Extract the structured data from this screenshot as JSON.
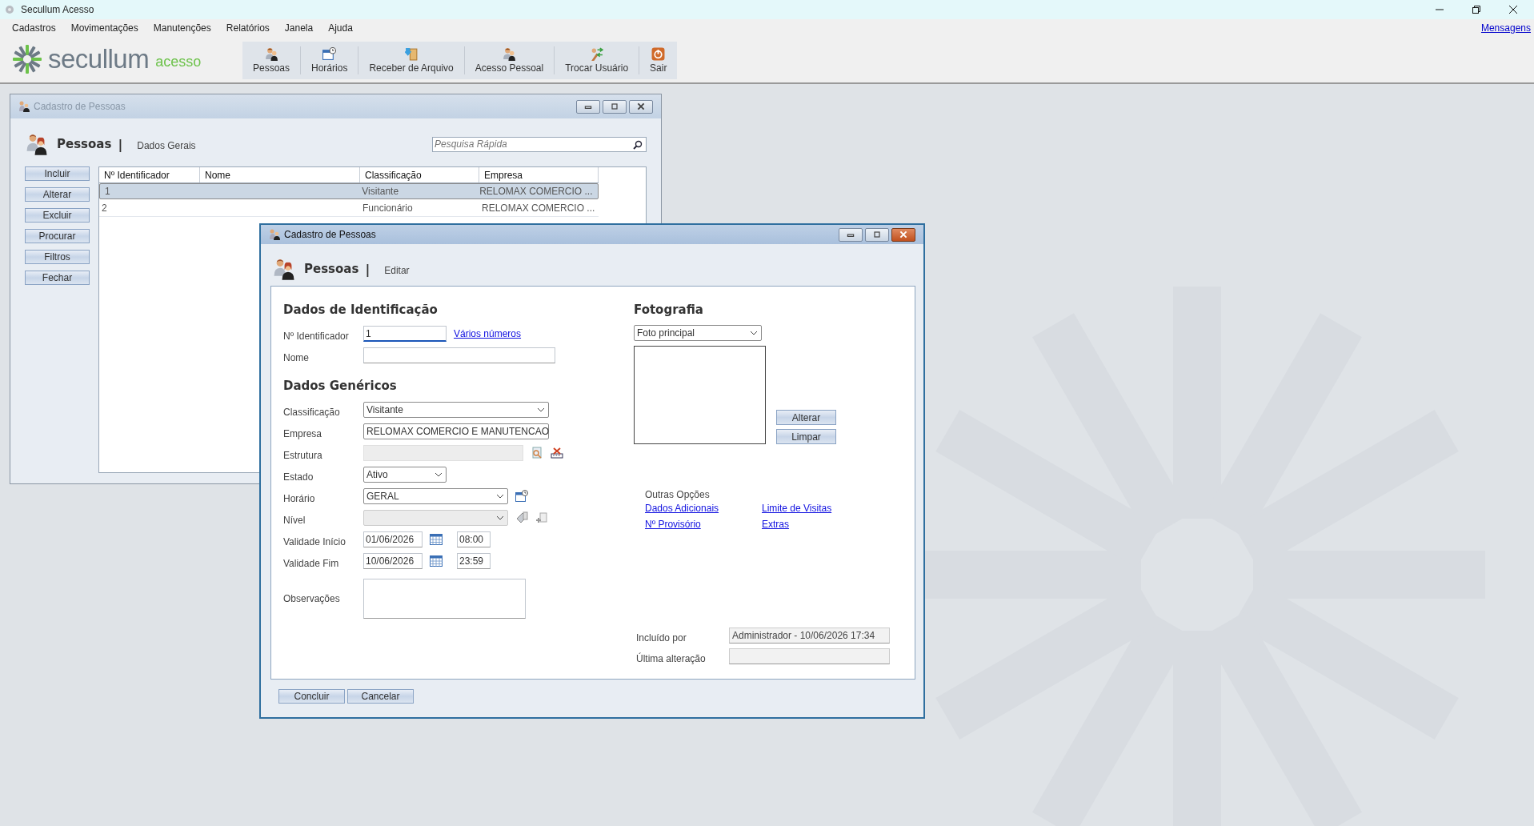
{
  "window": {
    "title": "Secullum Acesso"
  },
  "menu": [
    "Cadastros",
    "Movimentações",
    "Manutenções",
    "Relatórios",
    "Janela",
    "Ajuda"
  ],
  "messages_link": "Mensagens",
  "logo": {
    "name": "secullum",
    "product": "acesso"
  },
  "toolbar": [
    {
      "label": "Pessoas",
      "kind": "person"
    },
    {
      "label": "Horários",
      "kind": "schedule"
    },
    {
      "label": "Receber de Arquivo",
      "kind": "file"
    },
    {
      "label": "Acesso Pessoal",
      "kind": "person"
    },
    {
      "label": "Trocar Usuário",
      "kind": "swap"
    },
    {
      "label": "Sair",
      "kind": "power"
    }
  ],
  "back_window": {
    "title": "Cadastro de Pessoas",
    "heading": "Pessoas",
    "separator": "|",
    "section": "Dados Gerais",
    "search": {
      "placeholder": "Pesquisa Rápida"
    },
    "buttons": [
      "Incluir",
      "Alterar",
      "Excluir",
      "Procurar",
      "Filtros",
      "Fechar"
    ],
    "table": {
      "columns": [
        "Nº Identificador",
        "Nome",
        "Classificação",
        "Empresa"
      ],
      "rows": [
        {
          "cells": [
            "1",
            "",
            "Visitante",
            "RELOMAX COMERCIO ..."
          ],
          "selected": true
        },
        {
          "cells": [
            "2",
            "",
            "Funcionário",
            "RELOMAX COMERCIO ..."
          ],
          "selected": false
        }
      ]
    }
  },
  "dialog": {
    "title": "Cadastro de Pessoas",
    "heading": "Pessoas",
    "separator": "|",
    "section": "Editar",
    "identification": {
      "title": "Dados de Identificação",
      "rows": [
        {
          "kind": "input-link",
          "label": "Nº Identificador",
          "value": "1",
          "link": "Vários números"
        },
        {
          "kind": "input",
          "label": "Nome"
        }
      ]
    },
    "generic": {
      "title": "Dados Genéricos",
      "rows": [
        {
          "kind": "select",
          "label": "Classificação",
          "value": "Visitante"
        },
        {
          "kind": "select",
          "label": "Empresa",
          "value": "RELOMAX COMERCIO E MANUTENCAO"
        },
        {
          "kind": "lookup",
          "label": "Estrutura"
        },
        {
          "kind": "select-short",
          "label": "Estado",
          "value": "Ativo"
        },
        {
          "kind": "select-schedule",
          "label": "Horário",
          "value": "GERAL"
        },
        {
          "kind": "select-disabled",
          "label": "Nível"
        },
        {
          "kind": "datetime",
          "label": "Validade Início",
          "date": "01/06/2026",
          "time": "08:00"
        },
        {
          "kind": "datetime",
          "label": "Validade Fim",
          "date": "10/06/2026",
          "time": "23:59"
        },
        {
          "kind": "textarea",
          "label": "Observações"
        }
      ]
    },
    "photo": {
      "title": "Fotografia",
      "selector": "Foto principal",
      "buttons": [
        "Alterar",
        "Limpar"
      ]
    },
    "other_options": {
      "title": "Outras Opções",
      "links": [
        "Dados Adicionais",
        "Limite de Visitas",
        "Nº Provisório",
        "Extras"
      ]
    },
    "audit": [
      {
        "label": "Incluído por",
        "value": "Administrador - 10/06/2026 17:34"
      },
      {
        "label": "Última alteração"
      }
    ],
    "buttons": [
      "Concluir",
      "Cancelar"
    ]
  }
}
